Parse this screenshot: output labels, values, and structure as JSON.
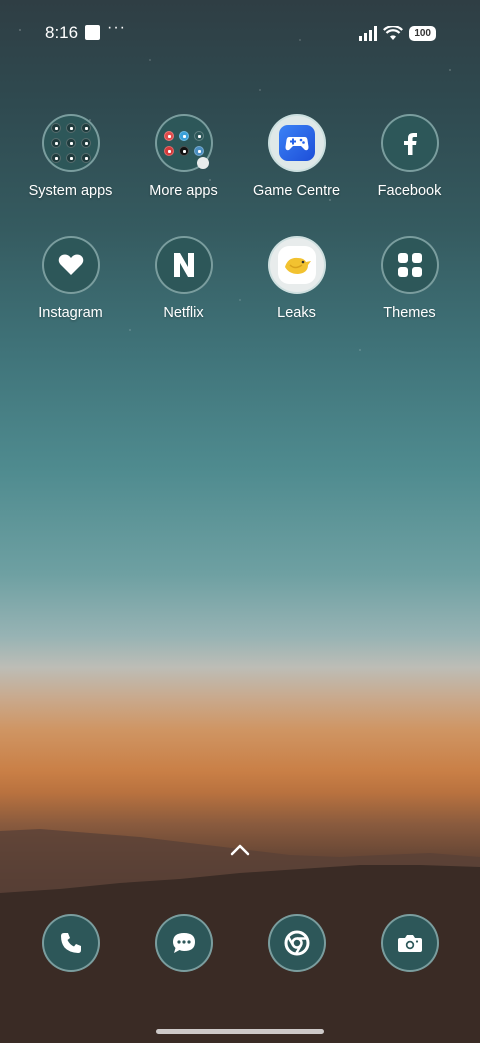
{
  "status_bar": {
    "time": "8:16",
    "more_indicator": "···",
    "battery": "100"
  },
  "apps": [
    {
      "label": "System apps",
      "icon": "system-apps-folder-icon"
    },
    {
      "label": "More apps",
      "icon": "more-apps-folder-icon"
    },
    {
      "label": "Game Centre",
      "icon": "game-controller-icon"
    },
    {
      "label": "Facebook",
      "icon": "facebook-icon"
    },
    {
      "label": "Instagram",
      "icon": "heart-icon"
    },
    {
      "label": "Netflix",
      "icon": "netflix-n-icon"
    },
    {
      "label": "Leaks",
      "icon": "leaks-bird-icon"
    },
    {
      "label": "Themes",
      "icon": "themes-grid-icon"
    }
  ],
  "dock": [
    {
      "icon": "phone-icon"
    },
    {
      "icon": "messages-icon"
    },
    {
      "icon": "chrome-icon"
    },
    {
      "icon": "camera-icon"
    }
  ],
  "colors": {
    "icon_bg": "#2d5759",
    "icon_border": "#b9d7d7",
    "sky_top": "#2f3e44",
    "horizon_orange": "#c97f46",
    "ground": "#332722"
  }
}
